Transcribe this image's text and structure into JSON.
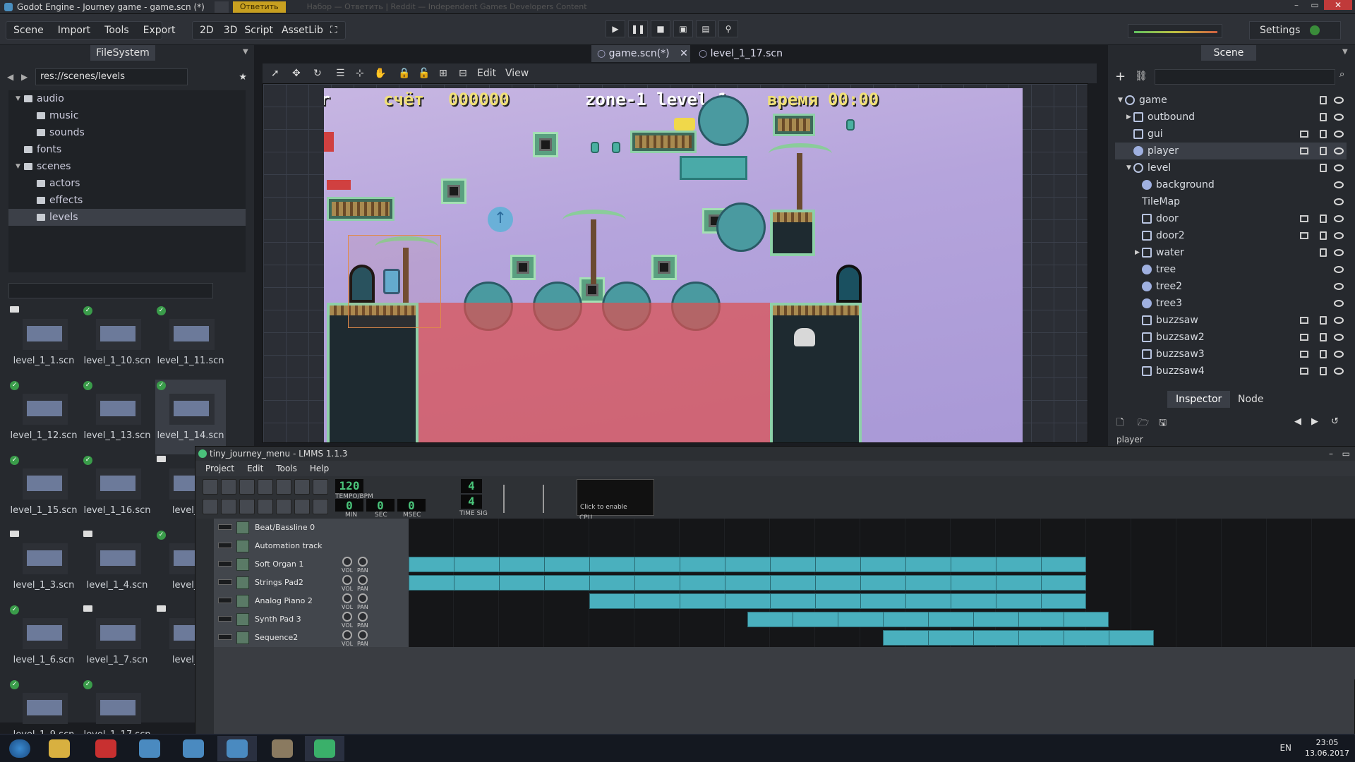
{
  "window": {
    "title": "Godot Engine - Journey game - game.scn (*)",
    "blurred_tabs": [
      "",
      "Ответить"
    ],
    "blurred_title": "Набор — Ответить | Reddit — Independent Games Developers Content"
  },
  "menu": {
    "left": [
      "Scene",
      "Import",
      "Tools",
      "Export"
    ],
    "modes": [
      "2D",
      "3D",
      "Script",
      "AssetLib"
    ],
    "settings": "Settings"
  },
  "playback": {
    "icons": [
      "play-icon",
      "pause-icon",
      "stop-icon",
      "play-scene-icon",
      "play-custom-icon",
      "remote-icon"
    ]
  },
  "filesystem": {
    "tab": "FileSystem",
    "path": "res://scenes/levels",
    "tree": [
      {
        "label": "audio",
        "expanded": true
      },
      {
        "label": "music"
      },
      {
        "label": "sounds"
      },
      {
        "label": "fonts"
      },
      {
        "label": "scenes",
        "expanded": true
      },
      {
        "label": "actors"
      },
      {
        "label": "effects"
      },
      {
        "label": "levels",
        "selected": true
      }
    ],
    "files": [
      {
        "name": "level_1_1.scn",
        "mark": "film"
      },
      {
        "name": "level_1_10.scn",
        "mark": "check"
      },
      {
        "name": "level_1_11.scn",
        "mark": "check"
      },
      {
        "name": "level_1_12.scn",
        "mark": "check"
      },
      {
        "name": "level_1_13.scn",
        "mark": "check"
      },
      {
        "name": "level_1_14.scn",
        "mark": "check",
        "selected": true
      },
      {
        "name": "level_1_15.scn",
        "mark": "check"
      },
      {
        "name": "level_1_16.scn",
        "mark": "check"
      },
      {
        "name": "level_1_",
        "mark": "film"
      },
      {
        "name": "level_1_3.scn",
        "mark": "film"
      },
      {
        "name": "level_1_4.scn",
        "mark": "film"
      },
      {
        "name": "level_1_",
        "mark": "check"
      },
      {
        "name": "level_1_6.scn",
        "mark": "check"
      },
      {
        "name": "level_1_7.scn",
        "mark": "film"
      },
      {
        "name": "level_1_",
        "mark": "film"
      },
      {
        "name": "level_1_9.scn",
        "mark": "check"
      },
      {
        "name": "level_1_17.scn",
        "mark": "check"
      }
    ]
  },
  "editor": {
    "tabs": [
      "game.scn(*)",
      "level_1_17.scn"
    ],
    "toolbar_menus": [
      "Edit",
      "View"
    ],
    "hud": {
      "player": "player",
      "score_label": "счёт",
      "score": "000000",
      "zone": "zone-1 level-1",
      "time_label": "время",
      "time": "00:00"
    }
  },
  "scene": {
    "tab": "Scene",
    "nodes": [
      {
        "label": "game",
        "depth": 0,
        "arrow": "▼",
        "icon": "node-icon"
      },
      {
        "label": "outbound",
        "depth": 1,
        "arrow": "▶",
        "icon": "instance-icon"
      },
      {
        "label": "gui",
        "depth": 1,
        "arrow": "",
        "icon": "control-icon"
      },
      {
        "label": "player",
        "depth": 1,
        "arrow": "",
        "icon": "player-icon",
        "selected": true
      },
      {
        "label": "level",
        "depth": 1,
        "arrow": "▼",
        "icon": "node-icon"
      },
      {
        "label": "background",
        "depth": 2,
        "arrow": "",
        "icon": "sprite-icon"
      },
      {
        "label": "TileMap",
        "depth": 2,
        "arrow": "",
        "icon": "tilemap-icon"
      },
      {
        "label": "door",
        "depth": 2,
        "arrow": "",
        "icon": "instance-icon"
      },
      {
        "label": "door2",
        "depth": 2,
        "arrow": "",
        "icon": "instance-icon"
      },
      {
        "label": "water",
        "depth": 2,
        "arrow": "▶",
        "icon": "instance-icon"
      },
      {
        "label": "tree",
        "depth": 2,
        "arrow": "",
        "icon": "sprite-icon"
      },
      {
        "label": "tree2",
        "depth": 2,
        "arrow": "",
        "icon": "sprite-icon"
      },
      {
        "label": "tree3",
        "depth": 2,
        "arrow": "",
        "icon": "sprite-icon"
      },
      {
        "label": "buzzsaw",
        "depth": 2,
        "arrow": "",
        "icon": "instance-icon"
      },
      {
        "label": "buzzsaw2",
        "depth": 2,
        "arrow": "",
        "icon": "instance-icon"
      },
      {
        "label": "buzzsaw3",
        "depth": 2,
        "arrow": "",
        "icon": "instance-icon"
      },
      {
        "label": "buzzsaw4",
        "depth": 2,
        "arrow": "",
        "icon": "instance-icon"
      }
    ],
    "inspector_tabs": [
      "Inspector",
      "Node"
    ],
    "inspector_node": "player"
  },
  "lmms": {
    "title": "tiny_journey_menu - LMMS 1.1.3",
    "menu": [
      "Project",
      "Edit",
      "Tools",
      "Help"
    ],
    "tempo": "120",
    "tempo_label": "TEMPO/BPM",
    "min": "0",
    "sec": "0",
    "msec": "0",
    "min_label": "MIN",
    "sec_label": "SEC",
    "msec_label": "MSEC",
    "ts_top": "4",
    "ts_bottom": "4",
    "ts_label": "TIME SIG",
    "cpu_text": "Click to enable",
    "cpu_label": "CPU",
    "tracks": [
      {
        "name": "Beat/Bassline 0",
        "type": "bb"
      },
      {
        "name": "Automation track",
        "type": "auto"
      },
      {
        "name": "Soft Organ 1",
        "type": "inst",
        "clips": [
          [
            0,
            15
          ]
        ]
      },
      {
        "name": "Strings Pad2",
        "type": "inst",
        "clips": [
          [
            0,
            15
          ]
        ]
      },
      {
        "name": "Analog Piano 2",
        "type": "inst",
        "clips": [
          [
            4,
            15
          ]
        ]
      },
      {
        "name": "Synth Pad 3",
        "type": "inst",
        "clips": [
          [
            7.5,
            15.5
          ]
        ]
      },
      {
        "name": "Sequence2",
        "type": "inst",
        "clips": [
          [
            10.5,
            16.5
          ]
        ]
      }
    ],
    "vol_label": "VOL",
    "pan_label": "PAN"
  },
  "taskbar": {
    "lang": "EN",
    "time": "23:05",
    "date": "13.06.2017"
  }
}
